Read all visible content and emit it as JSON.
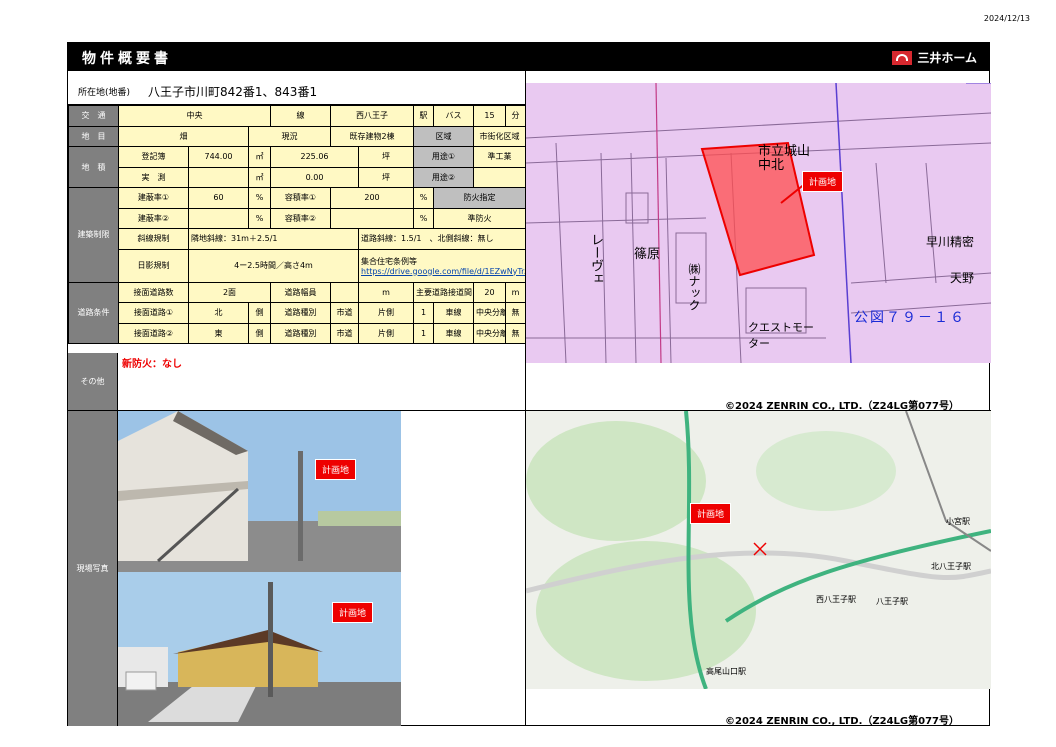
{
  "date": "2024/12/13",
  "header": {
    "title": "物件概要書",
    "logo_text": "三井ホーム"
  },
  "address": {
    "label": "所在地(地番)",
    "value": "八王子市川町842番1、843番1"
  },
  "spec": {
    "r1": {
      "h": "交　通",
      "line": "中央",
      "line_unit": "線",
      "station": "西八王子",
      "station_unit": "駅",
      "bus": "バス",
      "bus_min": "15",
      "min_unit": "分"
    },
    "r2": {
      "h": "地　目",
      "chimoku": "畑",
      "genkyo_h": "現況",
      "genkyo": "既存建物2棟",
      "kuiki_h": "区域",
      "kuiki": "市街化区域"
    },
    "r3": {
      "h": "地　積",
      "sub": "登記簿",
      "reg_m2": "744.00",
      "m2": "㎡",
      "reg_tsubo": "225.06",
      "tsubo": "坪",
      "yoto1_h": "用途①",
      "yoto1": "準工業"
    },
    "r4": {
      "sub": "実　測",
      "act_m2": "",
      "m2": "㎡",
      "act_tsubo": "0.00",
      "tsubo": "坪",
      "yoto2_h": "用途②",
      "yoto2": ""
    },
    "r5": {
      "h": "建築制限",
      "kenpei1_h": "建蔽率①",
      "kenpei1": "60",
      "pct": "%",
      "yoseki1_h": "容積率①",
      "yoseki1": "200",
      "bouka_h": "防火指定"
    },
    "r6": {
      "kenpei2_h": "建蔽率②",
      "kenpei2": "",
      "pct": "%",
      "yoseki2_h": "容積率②",
      "yoseki2": "",
      "bouka": "準防火"
    },
    "r7": {
      "shasen_h": "斜線規制",
      "rinchi": "隣地斜線：31m＋2.5/1",
      "doro": "道路斜線：1.5/1　、北側斜線：無し"
    },
    "r8": {
      "hikage_h": "日影規制",
      "hikage": "4ー2.5時間／高さ4m",
      "shugo_h": "集合住宅条例等",
      "link": "https://drive.google.com/file/d/1EZwNyTrAKyJH8mF"
    },
    "r9": {
      "h": "道路条件",
      "road_count_h": "接面道路数",
      "road_count": "2面",
      "width_h": "道路幅員",
      "width": "",
      "m": "m",
      "frontage_h": "主要道路接道間口",
      "frontage": "20",
      "m2": "m"
    },
    "r10": {
      "road_h": "接面道路①",
      "dir": "北",
      "side": "側",
      "kind_h": "道路種別",
      "kind": "市道",
      "lanes_h": "片側",
      "lanes": "1",
      "lane_unit": "車線",
      "median_h": "中央分離帯",
      "median": "無"
    },
    "r11": {
      "road_h": "接面道路②",
      "dir": "東",
      "side": "側",
      "kind_h": "道路種別",
      "kind": "市道",
      "lanes_h": "片側",
      "lanes": "1",
      "lane_unit": "車線",
      "median_h": "中央分離帯",
      "median": "無"
    }
  },
  "other": {
    "h": "その他",
    "note": "新防火：なし"
  },
  "photos": {
    "h": "現場写真",
    "tag1": "計画地",
    "tag2": "計画地"
  },
  "map1": {
    "tag": "計画地",
    "koz": "公図７９－１６",
    "copyright": "©2024 ZENRIN CO., LTD.（Z24LG第077号）",
    "labels": {
      "jokan": "市立城山中北",
      "shinohara": "篠原",
      "nack": "㈱ナック",
      "revue": "レーヴェ",
      "hayakawa": "早川精密",
      "motor": "クエストモーター",
      "tenno": "天野"
    }
  },
  "map2": {
    "tag": "計画地",
    "copyright": "©2024 ZENRIN CO., LTD.（Z24LG第077号）",
    "labels": {
      "nishi": "西八王子駅",
      "hachi": "八王子駅",
      "takao": "高尾山口駅",
      "kita": "北八王子駅",
      "koyasu": "小宮駅"
    }
  },
  "colors": {
    "header": "#000000",
    "cell_head": "#808080",
    "cell_yellow": "#fff9c4",
    "accent_red": "#e00000",
    "map1_bg": "#e9c9f1"
  }
}
